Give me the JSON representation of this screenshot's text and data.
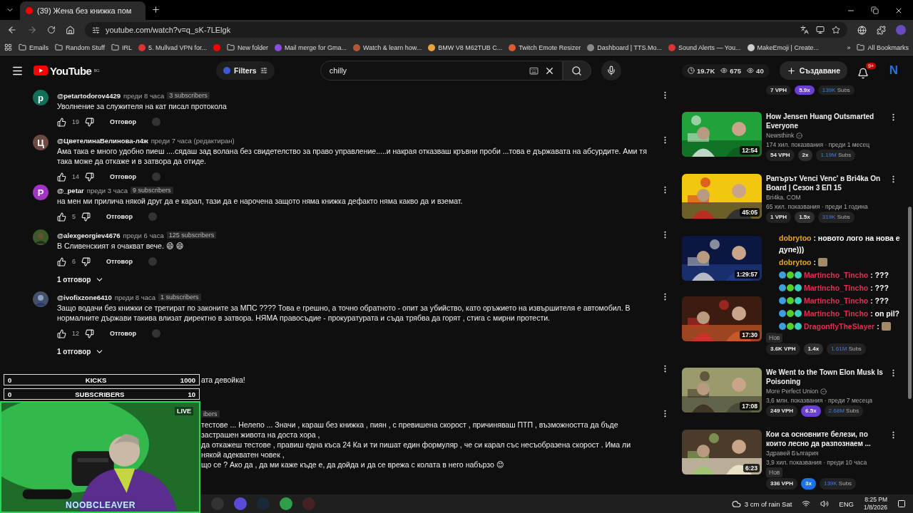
{
  "browser": {
    "tab": {
      "title": "(39) Жена без книжка пом",
      "selected": true
    },
    "url": "youtube.com/watch?v=q_sK-7LElgk",
    "bookmarks": [
      {
        "label": "Emails",
        "kind": "folder"
      },
      {
        "label": "Random Stuff",
        "kind": "folder"
      },
      {
        "label": "IRL",
        "kind": "folder"
      },
      {
        "label": "5. Mullvad VPN for...",
        "kind": "site"
      },
      {
        "kind": "youtube"
      },
      {
        "label": "New folder",
        "kind": "folder"
      },
      {
        "label": "Mail merge for Gma...",
        "kind": "site"
      },
      {
        "label": "Watch & learn how...",
        "kind": "site"
      },
      {
        "label": "BMW V8 M62TUB C...",
        "kind": "site"
      },
      {
        "label": "Twitch Emote Resizer",
        "kind": "site"
      },
      {
        "label": "Dashboard | TTS.Mo...",
        "kind": "site"
      },
      {
        "label": "Sound Alerts — You...",
        "kind": "site"
      },
      {
        "label": "MakeEmoji | Create...",
        "kind": "site"
      }
    ],
    "more": "»",
    "all_bookmarks": "All Bookmarks"
  },
  "youtube": {
    "logo": "YouTube",
    "region": "BG",
    "filters": "Filters",
    "search": {
      "value": "chilly"
    },
    "stats": [
      "19.7K",
      "675",
      "40"
    ],
    "create": "Създаване",
    "notifications": "9+",
    "avatar": "N"
  },
  "comments": [
    {
      "avatar": {
        "letter": "p",
        "color": "#12705a"
      },
      "author": "@petartodorov4429",
      "time": "преди 8 часа",
      "subs": "3 subscribers",
      "lines": [
        {
          "text": "Уволнение за служителя на кат писал протокола"
        }
      ],
      "likes": "19",
      "reply": "Отговор"
    },
    {
      "avatar": {
        "letter": "Ц",
        "color": "#6d4b43"
      },
      "author": "@ЦветелинаВелинова-л4ж",
      "time": "преди 7 часа (редактиран)",
      "lines": [
        {
          "text": "Ама така  е много удобно пиеш ....сядаш зад волана без свидетелство за право управление.....и накрая отказваш кръвни проби ...това е държавата на абсурдите. Ами тя така може да откаже и в затвора да отиде."
        }
      ],
      "likes": "14",
      "reply": "Отговор"
    },
    {
      "avatar": {
        "letter": "P",
        "color": "#a234c4"
      },
      "author": "@_petar",
      "time": "преди 3 часа",
      "subs": "9 subscribers",
      "lines": [
        {
          "text": "на мен ми прилича някой друг да е карал, тази да е нарочена защото няма книжка дефакто няма какво да и вземат."
        }
      ],
      "likes": "5",
      "reply": "Отговор"
    },
    {
      "avatar": {
        "kind": "picture"
      },
      "author": "@alexgeorgiev4676",
      "time": "преди 6 часа",
      "subs": "125 subscribers",
      "lines": [
        {
          "text": "В Сливенският я очакват вече. 😄 😄"
        }
      ],
      "likes": "6",
      "reply": "Отговор",
      "replies": "1 отговор"
    },
    {
      "avatar": {
        "kind": "picture"
      },
      "author": "@ivofixzone6410",
      "time": "преди 8 часа",
      "subs": "1 subscribers",
      "lines": [
        {
          "text": "Защо водачи без книжки се третират по законите за МПС ???? Това е грешно,   а точно обратното -  опит за убийство, като оръжието на извършителя е автомобил. В нормалните държави такива влизат директно в затвора. НЯМА правосъдие  - прокуратурата и съда трябва да горят , стига с мирни протести."
        }
      ],
      "likes": "12",
      "reply": "Отговор",
      "replies": "1 отговор"
    },
    {
      "lines": [
        {
          "text": "ата девойка!",
          "cut": true
        }
      ]
    },
    {
      "subs": "ibers",
      "subs_cut": true,
      "lines": [
        {
          "text": "тестове ... Нелепо ... Значи , караш без книжка , пиян , с превишена скорост , причиняваш ПТП , възможността да бъде застрашен живота на доста хора ,",
          "cut": true
        },
        {
          "text": "да откажеш тестове , правиш една къса 24 Ка и ти пишат един формуляр , че си карал със несъобразена скорост . Има ли някой адекватен човек ,",
          "cut": true
        },
        {
          "text": "що се ? Ако да , да ми каже къде е, да дойда и да се врежа с колата в него набързо 😊",
          "cut": true
        }
      ]
    }
  ],
  "sidebar": {
    "top_stats": [
      {
        "kind": "vph",
        "text": "7 VPH"
      },
      {
        "kind": "ratio",
        "text": "5.9x",
        "color": "#6b3fd4"
      },
      {
        "kind": "subs",
        "value": "139K",
        "unit": "Subs"
      }
    ],
    "videos": [
      {
        "title": "How Jensen Huang Outsmarted Everyone",
        "channel": "Newsthink",
        "verified": true,
        "meta": "174 хил. показвания · преди 1 месец",
        "duration": "12:54",
        "stats": [
          {
            "kind": "vph",
            "text": "54 VPH"
          },
          {
            "kind": "ratio",
            "text": "2x",
            "color": "#2f2f2f"
          },
          {
            "kind": "subs",
            "value": "1.19M",
            "unit": "Subs"
          }
        ]
      },
      {
        "title": "Рапърът Venci Venc' в Bri4ka On Board | Сезон 3 ЕП 15",
        "channel": "Bri4ka. COM",
        "meta": "65 хил. показвания · преди 1 година",
        "duration": "45:05",
        "stats": [
          {
            "kind": "vph",
            "text": "1 VPH"
          },
          {
            "kind": "ratio",
            "text": "1.5x",
            "color": "#2f2f2f"
          },
          {
            "kind": "subs",
            "value": "319K",
            "unit": "Subs"
          }
        ]
      },
      {
        "covered": true,
        "duration": "1:29:57"
      },
      {
        "covered": true,
        "duration": "17:30",
        "new": "Нов",
        "stats": [
          {
            "kind": "vph",
            "text": "3.6K VPH"
          },
          {
            "kind": "ratio",
            "text": "1.4x",
            "color": "#2f2f2f"
          },
          {
            "kind": "subs",
            "value": "1.61M",
            "unit": "Subs"
          }
        ]
      },
      {
        "title": "We Went to the Town Elon Musk Is Poisoning",
        "channel": "More Perfect Union",
        "verified": true,
        "meta": "3,6 млн. показвания · преди 7 месеца",
        "duration": "17:08",
        "stats": [
          {
            "kind": "vph",
            "text": "249 VPH"
          },
          {
            "kind": "ratio",
            "text": "6.5x",
            "color": "#6b3fd4"
          },
          {
            "kind": "subs",
            "value": "2.68M",
            "unit": "Subs"
          }
        ]
      },
      {
        "title": "Кои са основните белези, по които лесно да разпознаем ...",
        "channel": "Здравей България",
        "meta": "3,9 хил. показвания · преди 10 часа",
        "duration": "6:23",
        "new": "Нов",
        "stats": [
          {
            "kind": "vph",
            "text": "336 VPH"
          },
          {
            "kind": "ratio",
            "text": "3x",
            "color": "#1a73e8"
          },
          {
            "kind": "subs",
            "value": "139K",
            "unit": "Subs"
          }
        ]
      }
    ]
  },
  "chat": [
    {
      "user": "dobrytoo",
      "color": "#e6a81c",
      "separator": ":",
      "message": "новото лого на нова е дупе)))"
    },
    {
      "user": "dobrytoo",
      "color": "#e6a81c",
      "separator": ":",
      "emote": true
    },
    {
      "user": "Martincho_Tincho",
      "color": "#e03050",
      "separator": ":",
      "message": "???",
      "badges": true
    },
    {
      "user": "Martincho_Tincho",
      "color": "#e03050",
      "separator": ":",
      "message": "???",
      "badges": true
    },
    {
      "user": "Martincho_Tincho",
      "color": "#e03050",
      "separator": ":",
      "message": "???",
      "badges": true
    },
    {
      "user": "Martincho_Tincho",
      "color": "#e03050",
      "separator": ":",
      "message": "on pil?",
      "badges": true
    },
    {
      "user": "DragonflyTheSlayer",
      "color": "#e03050",
      "separator": ":",
      "emote": true,
      "badges": true
    }
  ],
  "stream": {
    "goals": [
      {
        "current": "0",
        "label": "KICKS",
        "target": "1000"
      },
      {
        "current": "0",
        "label": "SUBSCRIBERS",
        "target": "10"
      }
    ],
    "live": "LIVE",
    "name": "NOOBCLEAVER"
  },
  "taskbar": {
    "weather": "3 cm of rain Sat",
    "language": "ENG",
    "time": "8:25 PM",
    "date": "1/8/2026"
  }
}
